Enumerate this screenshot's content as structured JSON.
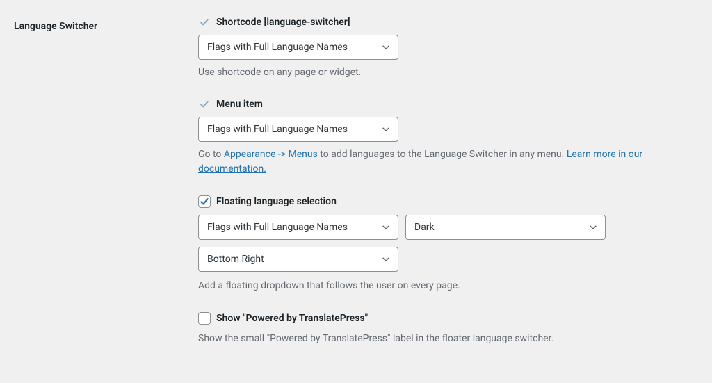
{
  "section": {
    "title": "Language Switcher"
  },
  "shortcode": {
    "label": "Shortcode [language-switcher]",
    "select": "Flags with Full Language Names",
    "desc": "Use shortcode on any page or widget."
  },
  "menuitem": {
    "label": "Menu item",
    "select": "Flags with Full Language Names",
    "desc_pre": "Go to ",
    "link1": "Appearance -> Menus",
    "desc_mid": " to add languages to the Language Switcher in any menu. ",
    "link2": "Learn more in our documentation."
  },
  "floating": {
    "label": "Floating language selection",
    "select_names": "Flags with Full Language Names",
    "select_theme": "Dark",
    "select_position": "Bottom Right",
    "desc": "Add a floating dropdown that follows the user on every page."
  },
  "powered": {
    "label": "Show \"Powered by TranslatePress\"",
    "desc": "Show the small \"Powered by TranslatePress\" label in the floater language switcher."
  }
}
